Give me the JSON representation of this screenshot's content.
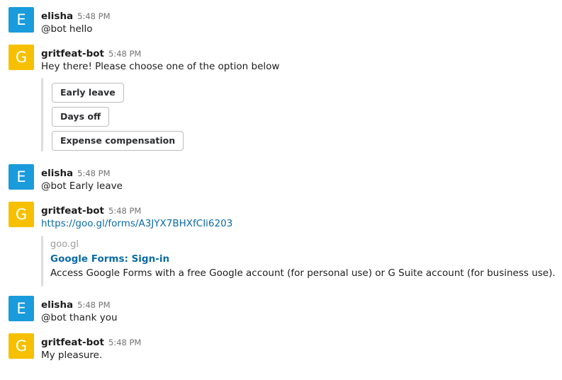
{
  "colors": {
    "avatar_e": "#1a9bdc",
    "avatar_g": "#f6c001",
    "link": "#0b6aa5",
    "timestamp": "#717274"
  },
  "messages": [
    {
      "avatar_letter": "E",
      "sender": "elisha",
      "time": "5:48 PM",
      "text": "@bot hello"
    },
    {
      "avatar_letter": "G",
      "sender": "gritfeat-bot",
      "time": "5:48 PM",
      "text": "Hey there! Please choose one of the option below",
      "buttons": [
        "Early leave",
        "Days off",
        "Expense compensation"
      ]
    },
    {
      "avatar_letter": "E",
      "sender": "elisha",
      "time": "5:48 PM",
      "text": "@bot Early leave"
    },
    {
      "avatar_letter": "G",
      "sender": "gritfeat-bot",
      "time": "5:48 PM",
      "link": "https://goo.gl/forms/A3JYX7BHXfCIi6203",
      "unfurl": {
        "site": "goo.gl",
        "title": "Google Forms: Sign-in",
        "description": "Access Google Forms with a free Google account (for personal use) or G Suite account (for business use)."
      }
    },
    {
      "avatar_letter": "E",
      "sender": "elisha",
      "time": "5:48 PM",
      "text": "@bot thank you"
    },
    {
      "avatar_letter": "G",
      "sender": "gritfeat-bot",
      "time": "5:48 PM",
      "text": "My pleasure."
    }
  ]
}
